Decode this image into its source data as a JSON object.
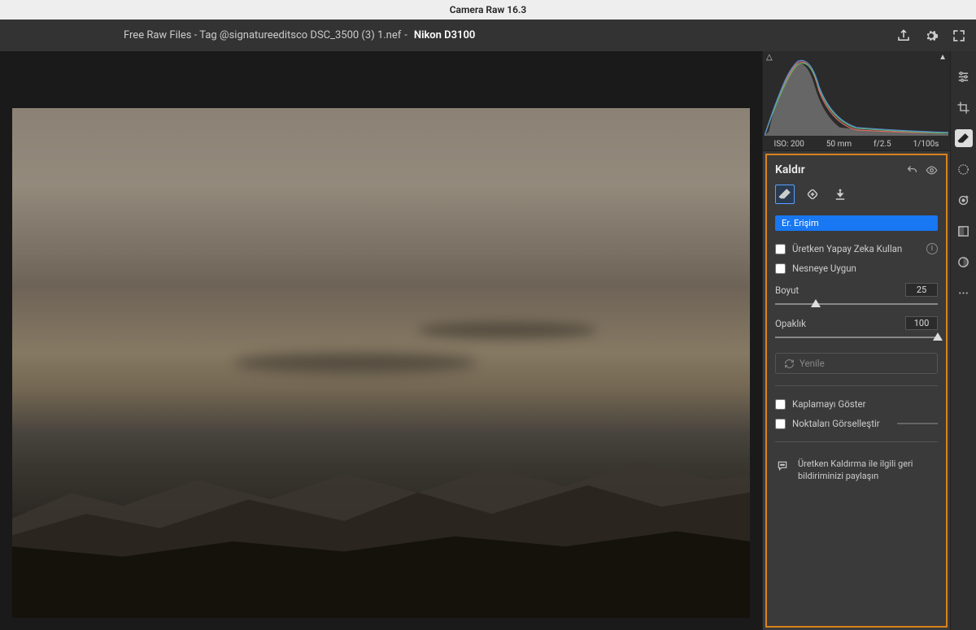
{
  "app": {
    "title": "Camera Raw 16.3"
  },
  "file": {
    "name": "Free Raw Files - Tag @signatureeditsco DSC_3500 (3) 1.nef",
    "separator": "  -  ",
    "camera": "Nikon D3100"
  },
  "meta": {
    "iso": "ISO: 200",
    "focal": "50 mm",
    "aperture": "f/2.5",
    "shutter": "1/100s"
  },
  "panel": {
    "title": "Kaldır",
    "chip": "Er. Erişim",
    "ai_label": "Üretken Yapay Zeka Kullan",
    "object_label": "Nesneye Uygun",
    "size_label": "Boyut",
    "size_value": "25",
    "opacity_label": "Opaklık",
    "opacity_value": "100",
    "refresh_label": "Yenile",
    "overlay_label": "Kaplamayı Göster",
    "points_label": "Noktaları Görselleştir",
    "feedback_text": "Üretken Kaldırma ile ilgili geri bildiriminizi paylaşın"
  }
}
